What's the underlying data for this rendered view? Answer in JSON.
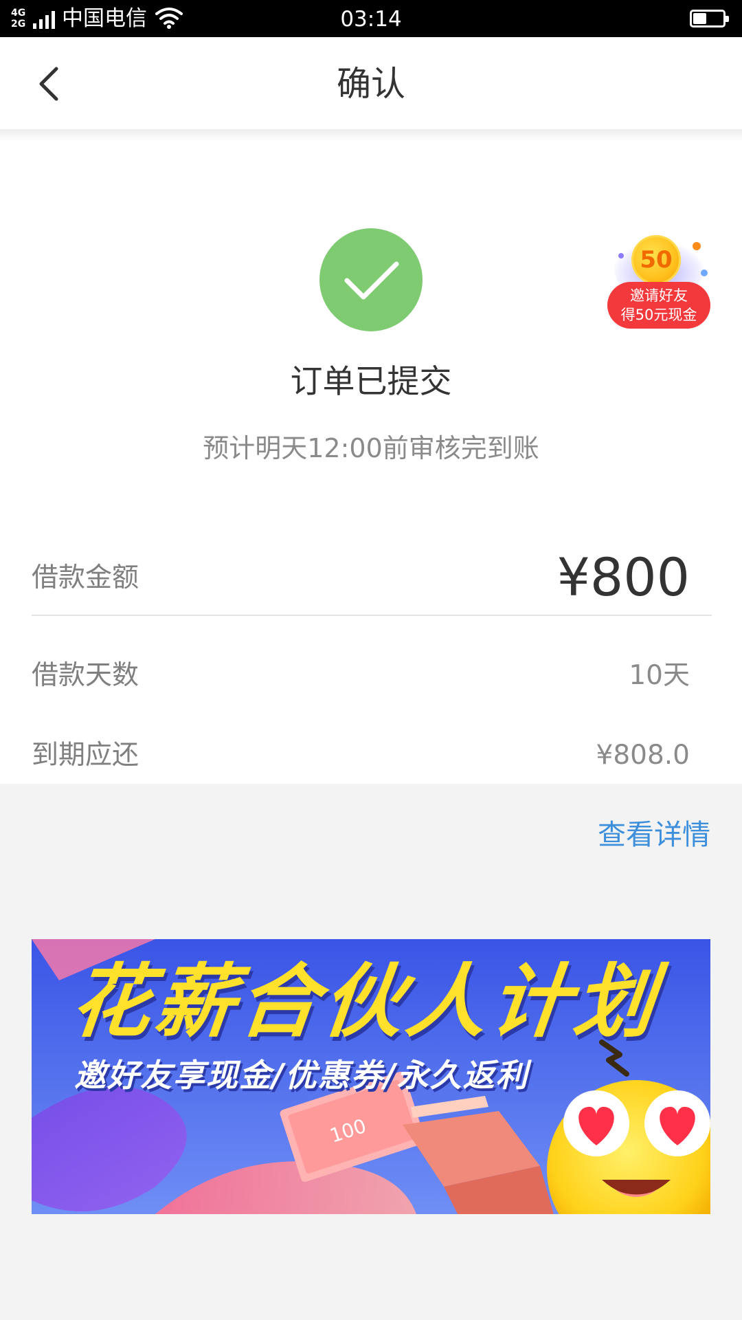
{
  "status_bar": {
    "network_type_top": "4G",
    "network_type_bottom": "2G",
    "carrier": "中国电信",
    "time": "03:14",
    "battery_level": 0.45
  },
  "nav": {
    "title": "确认",
    "back_icon": "chevron-left-icon"
  },
  "result": {
    "icon": "check-circle-icon",
    "icon_color": "#7ecb72",
    "title": "订单已提交",
    "subtitle": "预计明天12:00前审核完到账"
  },
  "invite_badge": {
    "coin_text": "50",
    "line1": "邀请好友",
    "line2": "得50元现金",
    "color": "#f4393d"
  },
  "loan_info": {
    "amount_label": "借款金额",
    "amount_value": "¥800",
    "days_label": "借款天数",
    "days_value": "10天",
    "due_label": "到期应还",
    "due_value": "¥808.0"
  },
  "view_details_label": "查看详情",
  "banner": {
    "title": "花薪合伙人计划",
    "subtitle": "邀好友享现金/优惠券/永久返利",
    "note_label": "100"
  },
  "colors": {
    "accent_blue": "#3d8fdc",
    "success_green": "#7ecb72",
    "banner_yellow": "#ffe02a",
    "banner_blue": "#3a55e6"
  }
}
